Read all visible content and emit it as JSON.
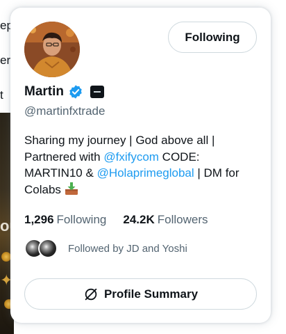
{
  "background": {
    "fragments": [
      "ep",
      "er",
      "t"
    ],
    "image_text": "ou"
  },
  "card": {
    "follow_button": "Following",
    "name": "Martin",
    "handle": "@martinfxtrade",
    "bio": {
      "line1": "Sharing my journey | God above all | Partnered with ",
      "mention1": "@fxifycom",
      "code": " CODE: MARTIN10 & ",
      "mention2": "@Holaprimeglobal",
      "tail": " | DM for Colabs "
    },
    "stats": {
      "following_count": "1,296",
      "following_label": "Following",
      "followers_count": "24.2K",
      "followers_label": "Followers"
    },
    "followed_by": "Followed by JD and Yoshi",
    "summary_button": "Profile Summary"
  },
  "colors": {
    "link": "#1d9bf0",
    "verified": "#1d9bf0",
    "secondary_text": "#536471",
    "border": "#cfd9de"
  },
  "icons": [
    "verified-badge-icon",
    "affiliate-badge-icon",
    "inbox-tray-emoji-icon",
    "profile-summary-icon"
  ]
}
